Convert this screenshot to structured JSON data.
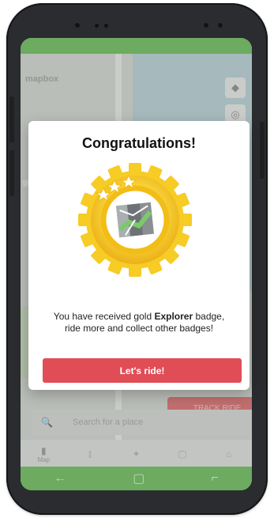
{
  "map": {
    "logo_text": "mapbox",
    "track_button_label": "TRACK RIDE",
    "search": {
      "placeholder": "Search for a place"
    },
    "layers_icon": "layers-icon",
    "location_icon": "location-icon"
  },
  "bottom_nav": {
    "items": [
      {
        "label": "Map",
        "icon": "map-icon"
      },
      {
        "label": "",
        "icon": "stats-icon"
      },
      {
        "label": "",
        "icon": "badge-icon"
      },
      {
        "label": "",
        "icon": "notes-icon"
      },
      {
        "label": "",
        "icon": "shop-icon"
      }
    ]
  },
  "dialog": {
    "title": "Congratulations!",
    "message_prefix": "You have received gold ",
    "message_bold": "Explorer",
    "message_suffix": " badge, ride more and collect other badges!",
    "cta_label": "Let's ride!"
  },
  "colors": {
    "accent_green": "#6bbf5a",
    "cta_red": "#e04d57",
    "badge_gold": "#f7c51e"
  }
}
